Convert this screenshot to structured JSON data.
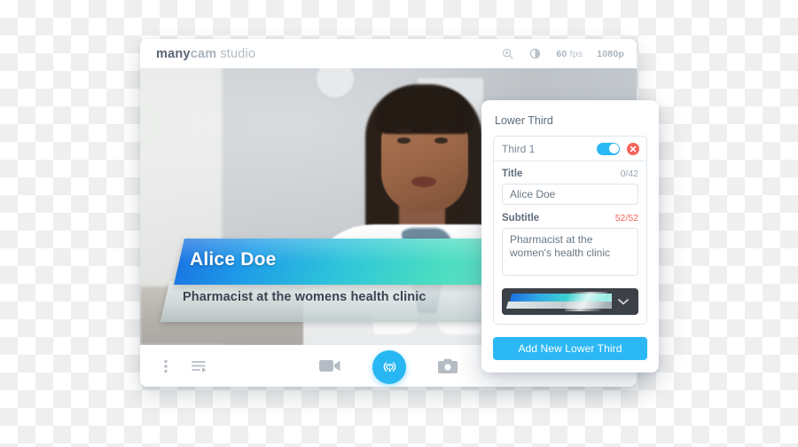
{
  "app": {
    "brand": {
      "many": "many",
      "cam": "cam",
      "studio": "studio"
    },
    "header": {
      "zoom_icon": "zoom-in-icon",
      "brightness_icon": "brightness-contrast-icon",
      "fps_value": "60",
      "fps_unit": "fps",
      "resolution": "1080p"
    },
    "toolbar": {
      "more_icon": "more-vertical-icon",
      "playlist_icon": "playlist-play-icon",
      "record_icon": "video-camera-icon",
      "broadcast_icon": "broadcast-icon",
      "snapshot_icon": "camera-snapshot-icon"
    }
  },
  "overlay": {
    "title": "Alice Doe",
    "subtitle": "Pharmacist at the womens health clinic"
  },
  "panel": {
    "heading": "Lower Third",
    "item": {
      "name": "Third 1",
      "enabled": true,
      "toggle_name": "enable-toggle",
      "close_icon": "close-circle-icon"
    },
    "title_field": {
      "label": "Title",
      "counter": "0/42",
      "value": "Alice Doe",
      "placeholder": "Title"
    },
    "subtitle_field": {
      "label": "Subtitle",
      "counter": "52/52",
      "counter_over": true,
      "value": "Pharmacist at the women's health clinic",
      "placeholder": "Subtitle"
    },
    "style_select": {
      "name": "lower-third-style-select",
      "caret_icon": "chevron-down-icon"
    },
    "add_button": "Add New Lower Third"
  },
  "colors": {
    "accent": "#2cb8f5",
    "danger": "#f4645a",
    "panel_bg": "#ffffff",
    "muted_text": "#9aa6b1",
    "select_bg": "#3c4147"
  }
}
